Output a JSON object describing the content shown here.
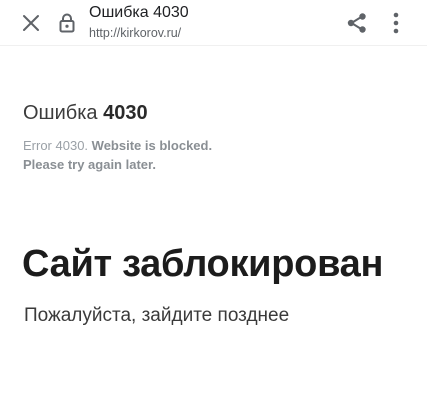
{
  "toolbar": {
    "title": "Ошибка 4030",
    "url": "http://kirkorov.ru/",
    "icons": {
      "close": "close-icon",
      "lock": "lock-icon",
      "share": "share-icon",
      "menu": "more-vert-icon"
    }
  },
  "content": {
    "error_word": "Ошибка",
    "error_code": "4030",
    "english_prefix": "Error 4030.",
    "english_bold_1": "Website is blocked.",
    "english_bold_2": "Please try again later.",
    "blocked_title": "Сайт заблокирован",
    "blocked_subtitle": "Пожалуйста, зайдите позднее"
  },
  "colors": {
    "icon": "#5f6368",
    "text_primary": "#1c1c1c",
    "text_muted": "#9aa0a6"
  }
}
